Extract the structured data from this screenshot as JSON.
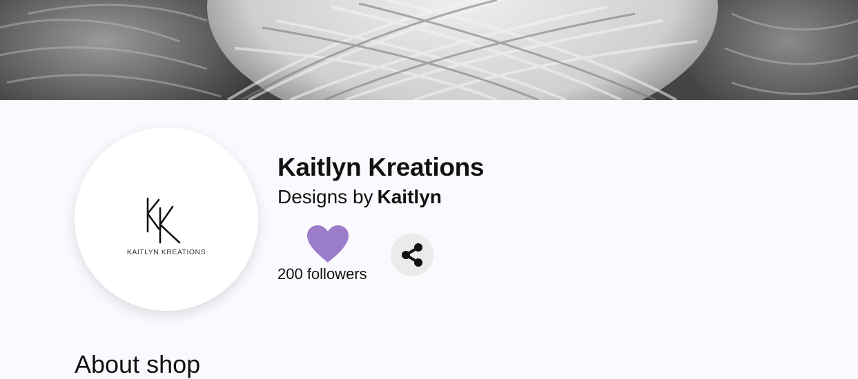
{
  "banner": {
    "icon": "yarn-balls-banner-image"
  },
  "logo": {
    "monogram": "KK",
    "text": "KAITLYN KREATIONS"
  },
  "shop": {
    "name": "Kaitlyn Kreations",
    "byline_prefix": "Designs by",
    "owner": "Kaitlyn",
    "followers": "200 followers"
  },
  "actions": {
    "follow_icon": "heart-icon",
    "share_icon": "share-icon",
    "heart_color": "#9b7ccb"
  },
  "sections": {
    "about_title": "About shop"
  }
}
